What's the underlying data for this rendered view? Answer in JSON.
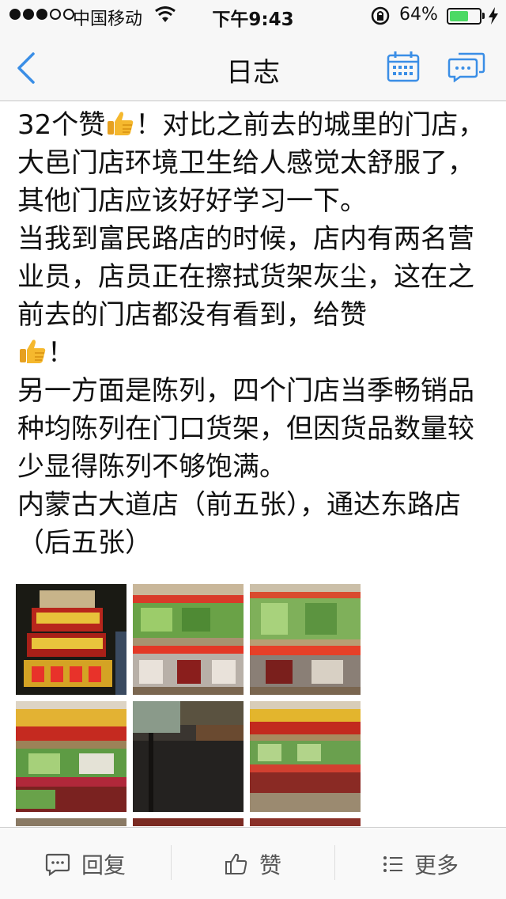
{
  "status_bar": {
    "carrier": "中国移动",
    "time": "下午9:43",
    "battery_percent": "64%",
    "battery_level": 0.64,
    "signal_strength": 3
  },
  "nav": {
    "title": "日志",
    "back_icon": "chevron-left-icon",
    "calendar_icon": "calendar-icon",
    "comments_icon": "chat-bubbles-icon"
  },
  "post": {
    "line_1": "32个赞",
    "line_1b": "！对比之前去的城里的门店，大邑门店环境卫生给人感觉太舒服了，其他门店应该好好学习一下。\n当我到富民路店的时候，店内有两名营业员，店员正在擦拭货架灰尘，这在之前去的门店都没有看到，给赞",
    "line_2b": "！\n另一方面是陈列，四个门店当季畅销品种均陈列在门口货架，但因货品数量较少显得陈列不够饱满。\n内蒙古大道店（前五张），通达东路店（后五张）"
  },
  "toolbar": {
    "reply_label": "回复",
    "like_label": "赞",
    "more_label": "更多"
  },
  "colors": {
    "accent": "#3a8ee6",
    "battery_green": "#4cd964",
    "thumbs_yellow": "#f5b82e"
  }
}
